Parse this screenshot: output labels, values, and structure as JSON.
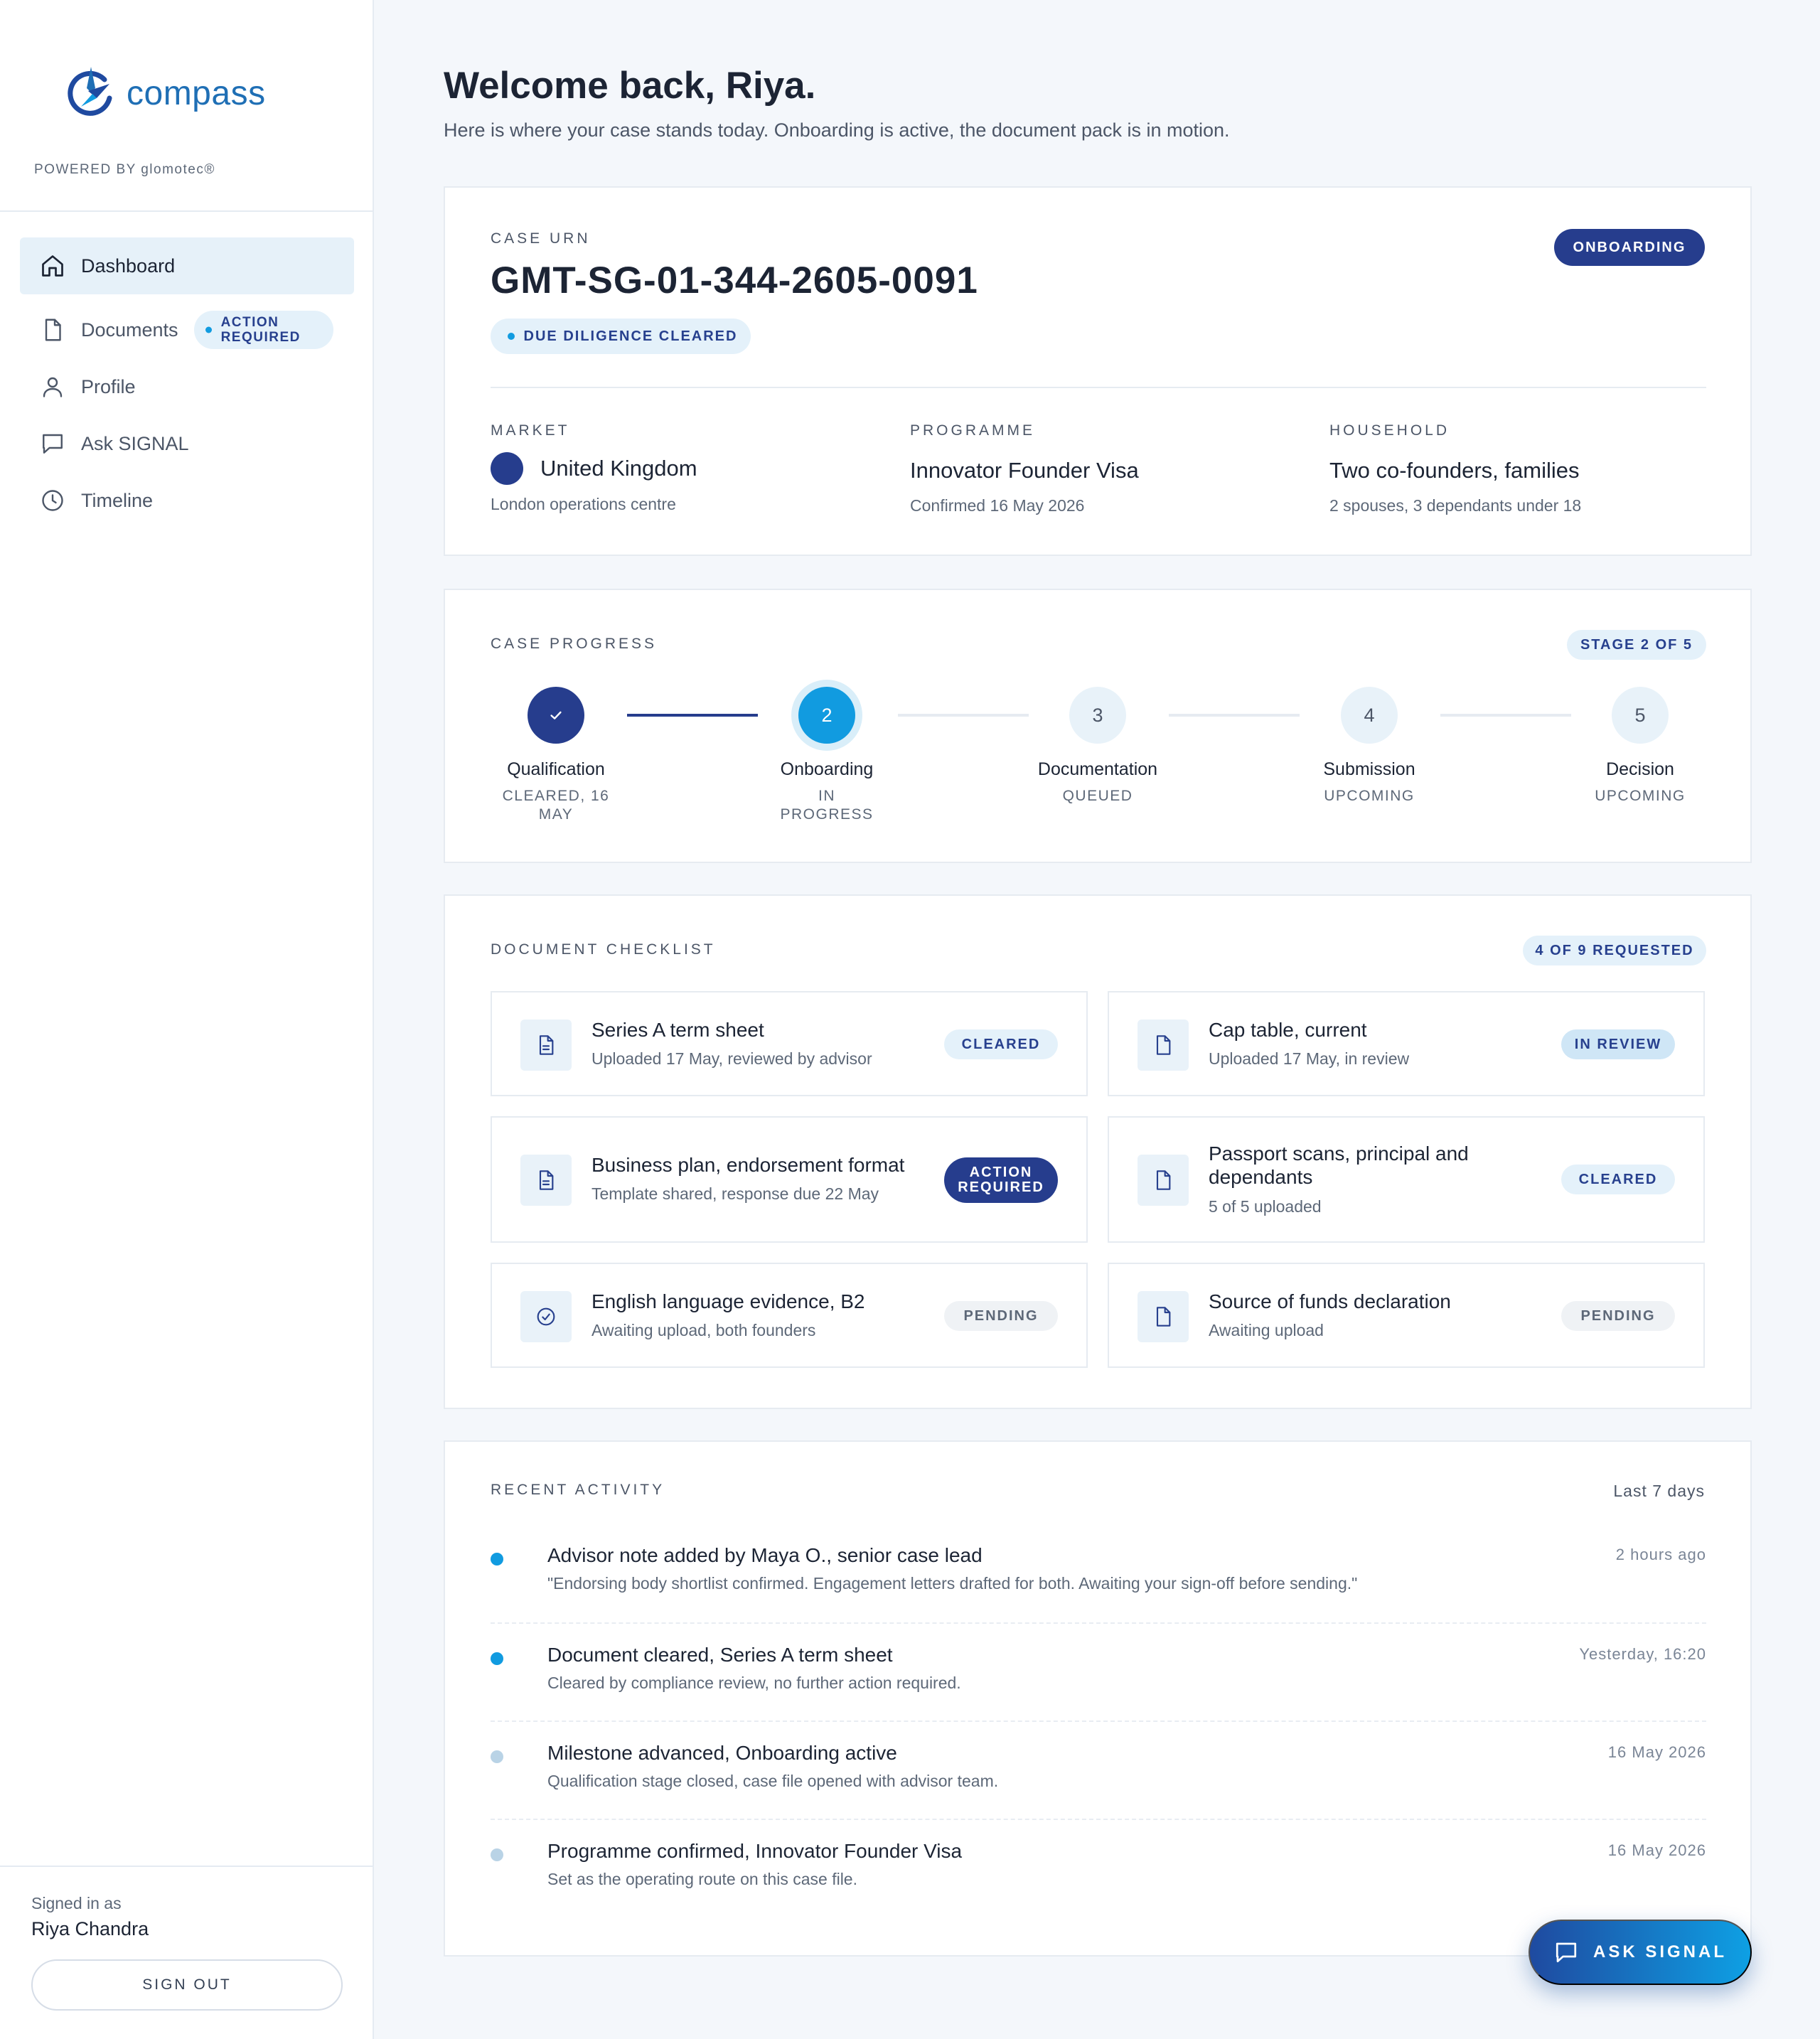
{
  "brand": {
    "name": "compass",
    "powered_by": "POWERED BY glomotec®"
  },
  "nav": [
    {
      "label": "Dashboard",
      "icon": "home-icon",
      "active": true
    },
    {
      "label": "Documents",
      "icon": "document-icon",
      "badge": "ACTION REQUIRED"
    },
    {
      "label": "Profile",
      "icon": "user-icon"
    },
    {
      "label": "Ask SIGNAL",
      "icon": "chat-icon"
    },
    {
      "label": "Timeline",
      "icon": "clock-icon"
    }
  ],
  "user": {
    "signed_in_label": "Signed in as",
    "name": "Riya Chandra",
    "sign_out": "SIGN OUT"
  },
  "header": {
    "title": "Welcome back, Riya.",
    "subtitle": "Here is where your case stands today. Onboarding is active, the document pack is in motion."
  },
  "case": {
    "urn_label": "CASE URN",
    "urn": "GMT-SG-01-344-2605-0091",
    "status": "ONBOARDING",
    "dd_badge": "DUE DILIGENCE CLEARED",
    "market": {
      "label": "MARKET",
      "value": "United Kingdom",
      "sub": "London operations centre"
    },
    "programme": {
      "label": "PROGRAMME",
      "value": "Innovator Founder Visa",
      "sub": "Confirmed 16 May 2026"
    },
    "household": {
      "label": "HOUSEHOLD",
      "value": "Two co-founders, families",
      "sub": "2 spouses, 3 dependants under 18"
    }
  },
  "progress": {
    "label": "CASE PROGRESS",
    "stage": "STAGE 2 OF 5",
    "steps": [
      {
        "number": "✓",
        "name": "Qualification",
        "status": "CLEARED, 16 MAY",
        "state": "done"
      },
      {
        "number": "2",
        "name": "Onboarding",
        "status": "IN PROGRESS",
        "state": "current"
      },
      {
        "number": "3",
        "name": "Documentation",
        "status": "QUEUED",
        "state": "todo"
      },
      {
        "number": "4",
        "name": "Submission",
        "status": "UPCOMING",
        "state": "todo"
      },
      {
        "number": "5",
        "name": "Decision",
        "status": "UPCOMING",
        "state": "todo"
      }
    ]
  },
  "documents": {
    "label": "DOCUMENT CHECKLIST",
    "count": "4 OF 9 REQUESTED",
    "items": [
      {
        "title": "Series A term sheet",
        "sub": "Uploaded 17 May, reviewed by advisor",
        "status": "CLEARED",
        "icon": "document-lines-icon"
      },
      {
        "title": "Cap table, current",
        "sub": "Uploaded 17 May, in review",
        "status": "IN REVIEW",
        "icon": "document-icon"
      },
      {
        "title": "Business plan, endorsement format",
        "sub": "Template shared, response due 22 May",
        "status": "ACTION REQUIRED",
        "icon": "document-lines-icon"
      },
      {
        "title": "Passport scans, principal and dependants",
        "sub": "5 of 5 uploaded",
        "status": "CLEARED",
        "icon": "document-icon"
      },
      {
        "title": "English language evidence, B2",
        "sub": "Awaiting upload, both founders",
        "status": "PENDING",
        "icon": "check-circle-icon"
      },
      {
        "title": "Source of funds declaration",
        "sub": "Awaiting upload",
        "status": "PENDING",
        "icon": "document-icon"
      }
    ]
  },
  "activity": {
    "label": "RECENT ACTIVITY",
    "range": "Last 7 days",
    "items": [
      {
        "title": "Advisor note added by Maya O., senior case lead",
        "sub": "\"Endorsing body shortlist confirmed. Engagement letters drafted for both. Awaiting your sign-off before sending.\"",
        "time": "2 hours ago",
        "dot": "#119be0"
      },
      {
        "title": "Document cleared, Series A term sheet",
        "sub": "Cleared by compliance review, no further action required.",
        "time": "Yesterday, 16:20",
        "dot": "#119be0"
      },
      {
        "title": "Milestone advanced, Onboarding active",
        "sub": "Qualification stage closed, case file opened with advisor team.",
        "time": "16 May 2026",
        "dot": "#b9d3e6"
      },
      {
        "title": "Programme confirmed, Innovator Founder Visa",
        "sub": "Set as the operating route on this case file.",
        "time": "16 May 2026",
        "dot": "#b9d3e6"
      }
    ]
  },
  "fab": {
    "label": "ASK SIGNAL",
    "icon": "chat-icon"
  },
  "colors": {
    "navy": "#263d8d",
    "accent": "#119be0",
    "background": "#f4f7fb"
  }
}
